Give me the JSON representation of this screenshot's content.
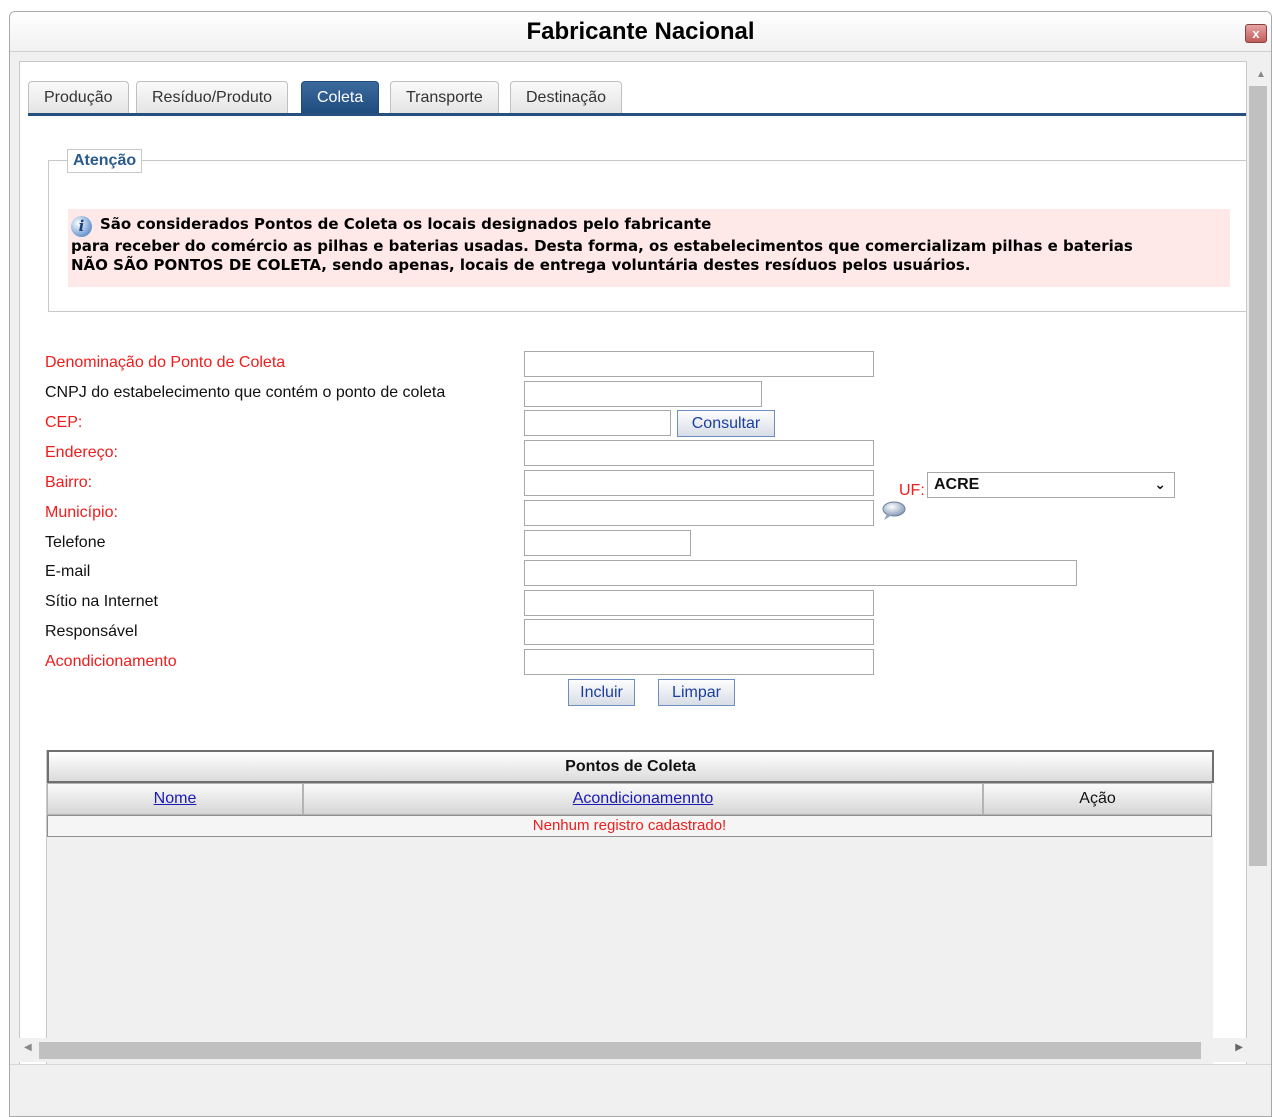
{
  "window": {
    "title": "Fabricante Nacional",
    "close_label": "x"
  },
  "tabs": [
    {
      "label": "Produção",
      "active": false
    },
    {
      "label": "Resíduo/Produto",
      "active": false
    },
    {
      "label": "Coleta",
      "active": true
    },
    {
      "label": "Transporte",
      "active": false
    },
    {
      "label": "Destinação",
      "active": false
    }
  ],
  "attention": {
    "legend": "Atenção",
    "lines": [
      "São considerados Pontos de Coleta os locais designados pelo fabricante",
      "para receber do comércio as pilhas e baterias usadas. Desta forma, os estabelecimentos que comercializam pilhas e baterias",
      "NÃO SÃO PONTOS DE COLETA, sendo apenas, locais de entrega voluntária destes resíduos pelos usuários."
    ]
  },
  "form": {
    "denominacao_label": "Denominação do Ponto de Coleta",
    "cnpj_label": "CNPJ do estabelecimento que contém o ponto de coleta",
    "cep_label": "CEP:",
    "consultar_label": "Consultar",
    "endereco_label": "Endereço:",
    "bairro_label": "Bairro:",
    "uf_label": "UF:",
    "uf_value": "ACRE",
    "municipio_label": "Município:",
    "telefone_label": "Telefone",
    "email_label": "E-mail",
    "sitio_label": "Sítio na Internet",
    "responsavel_label": "Responsável",
    "acondicionamento_label": "Acondicionamento",
    "incluir_label": "Incluir",
    "limpar_label": "Limpar"
  },
  "grid": {
    "title": "Pontos de Coleta",
    "columns": [
      "Nome",
      "Acondicionamennto",
      "Ação"
    ],
    "empty_message": "Nenhum registro cadastrado!"
  },
  "colors": {
    "accent": "#1e4c7f",
    "required": "#ee1c1c",
    "notice_bg": "#ffe8e8",
    "link": "#1a1ab5"
  }
}
